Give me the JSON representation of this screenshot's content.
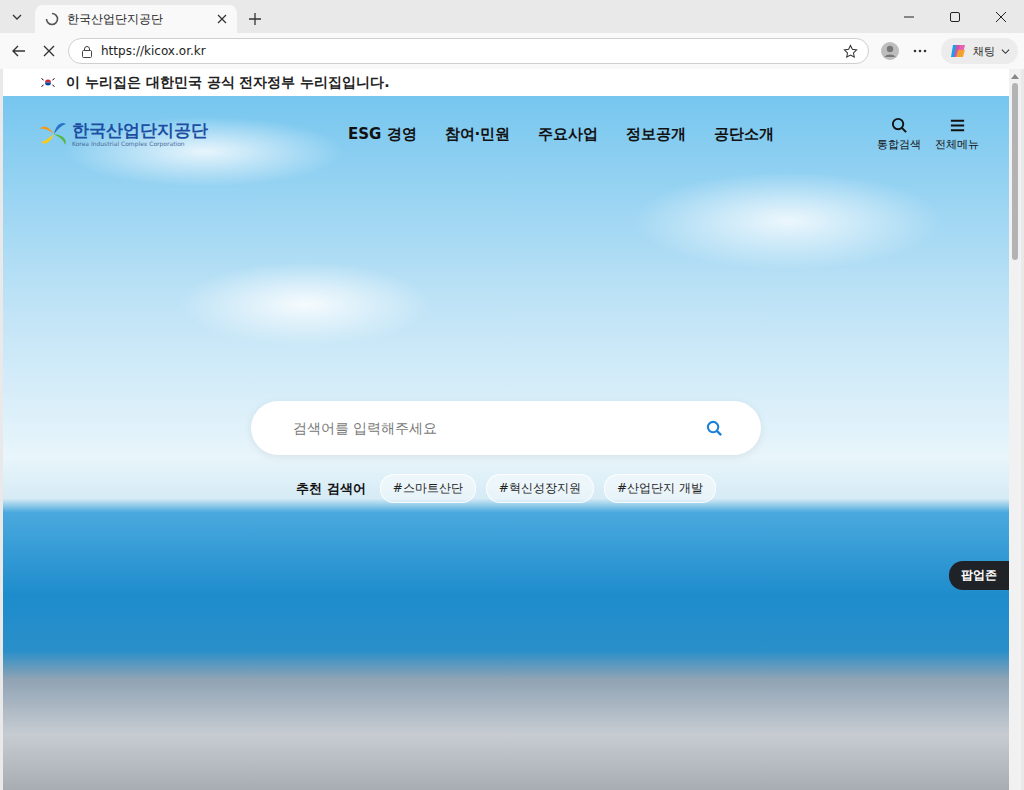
{
  "tabs": [
    {
      "label": "한국산업단지공단",
      "selected": true,
      "loading": true
    }
  ],
  "address_bar": {
    "url": "https://kicox.or.kr"
  },
  "copilot": {
    "label": "채팅"
  },
  "gov_banner": {
    "text": "이 누리집은 대한민국 공식 전자정부 누리집입니다."
  },
  "site": {
    "logo": {
      "name": "한국산업단지공단",
      "subtitle": "Korea Industrial Complex Corporation"
    },
    "nav": [
      {
        "label": "ESG 경영"
      },
      {
        "label": "참여·민원"
      },
      {
        "label": "주요사업"
      },
      {
        "label": "정보공개"
      },
      {
        "label": "공단소개"
      }
    ],
    "utilities": [
      {
        "label": "통합검색",
        "kind": "search"
      },
      {
        "label": "전체메뉴",
        "kind": "menu"
      }
    ],
    "search": {
      "placeholder": "검색어를 입력해주세요"
    },
    "recommended": {
      "label": "추천 검색어",
      "tags": [
        "#스마트산단",
        "#혁신성장지원",
        "#산업단지 개발"
      ]
    },
    "popup_zone": {
      "label": "팝업존"
    }
  },
  "scrollbar": {
    "level": 0.25
  }
}
